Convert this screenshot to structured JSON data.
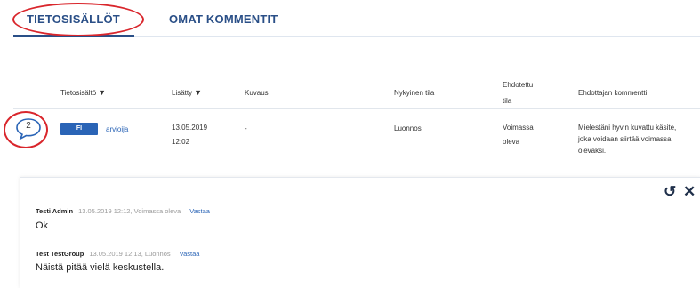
{
  "tabs": [
    {
      "label": "TIETOSISÄLLÖT"
    },
    {
      "label": "OMAT KOMMENTIT"
    }
  ],
  "table": {
    "headers": {
      "tietosisalto": "Tietosisältö",
      "lisatty": "Lisätty",
      "kuvaus": "Kuvaus",
      "nykyinen_tila": "Nykyinen tila",
      "ehdotettu_tila_1": "Ehdotettu",
      "ehdotettu_tila_2": "tila",
      "ehdottajan_kommentti": "Ehdottajan kommentti"
    },
    "sort_arrow": "▼",
    "row": {
      "comment_count": "2",
      "language": "FI",
      "term": "arvioija",
      "date": "13.05.2019",
      "time": "12:02",
      "description": "-",
      "current_state": "Luonnos",
      "proposed_state_1": "Voimassa",
      "proposed_state_2": "oleva",
      "comment_lines": [
        "Mielestäni hyvin kuvattu käsite,",
        "joka voidaan siirtää voimassa",
        "olevaksi."
      ]
    }
  },
  "comments_panel": {
    "undo_glyph": "↺",
    "close_glyph": "✕",
    "comments": [
      {
        "author": "Testi Admin",
        "meta": "13.05.2019 12:12, Voimassa oleva",
        "reply": "Vastaa",
        "text": "Ok"
      },
      {
        "author": "Test TestGroup",
        "meta": "13.05.2019 12:13, Luonnos",
        "reply": "Vastaa",
        "text": "Näistä pitää vielä keskustella."
      }
    ]
  },
  "colors": {
    "accent": "#2a4f87",
    "badge": "#2a64b6",
    "highlight_oval": "#d9262c"
  }
}
